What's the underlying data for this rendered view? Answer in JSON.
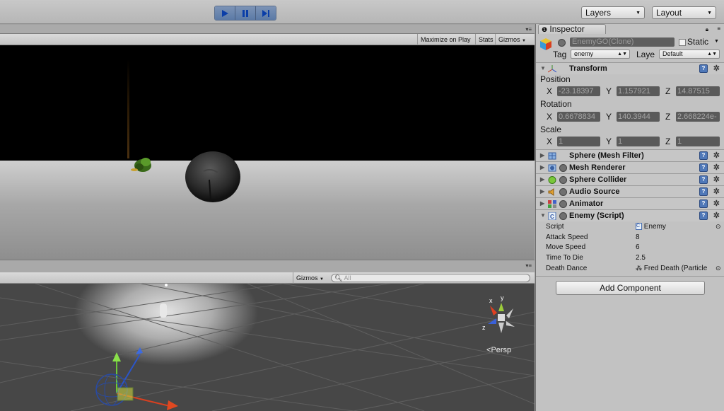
{
  "toolbar": {
    "play_buttons": [
      "play-icon",
      "pause-icon",
      "step-icon"
    ],
    "layers_label": "Layers",
    "layout_label": "Layout"
  },
  "game": {
    "maximize_label": "Maximize on Play",
    "stats_label": "Stats",
    "gizmos_label": "Gizmos"
  },
  "scene": {
    "gizmos_label": "Gizmos",
    "search_placeholder": "All",
    "persp_label": "Persp",
    "axis_x": "x",
    "axis_y": "y",
    "axis_z": "z"
  },
  "inspector": {
    "tab_label": "Inspector",
    "object_name": "EnemyGO(Clone)",
    "static_label": "Static",
    "tag_label": "Tag",
    "tag_value": "enemy",
    "layer_label": "Laye",
    "layer_value": "Default",
    "transform": {
      "title": "Transform",
      "position_label": "Position",
      "rotation_label": "Rotation",
      "scale_label": "Scale",
      "x": "X",
      "y": "Y",
      "z": "Z",
      "position": [
        "-23.18397",
        "1.157921",
        "14.87515"
      ],
      "rotation": [
        "0.6678834",
        "140.3944",
        "2.668224e-"
      ],
      "scale": [
        "1",
        "1",
        "1"
      ]
    },
    "components": [
      {
        "name": "Sphere (Mesh Filter)"
      },
      {
        "name": "Mesh Renderer"
      },
      {
        "name": "Sphere Collider"
      },
      {
        "name": "Audio Source"
      },
      {
        "name": "Animator"
      },
      {
        "name": "Enemy (Script)"
      }
    ],
    "script_props": [
      {
        "label": "Script",
        "value": "Enemy"
      },
      {
        "label": "Attack Speed",
        "value": "8"
      },
      {
        "label": "Move Speed",
        "value": "6"
      },
      {
        "label": "Time To Die",
        "value": "2.5"
      },
      {
        "label": "Death Dance",
        "value": "Fred Death (Particle"
      }
    ],
    "add_component_label": "Add Component"
  },
  "colors": {
    "accent_blue": "#4f78b8",
    "play_active": "#5b7aa6"
  }
}
